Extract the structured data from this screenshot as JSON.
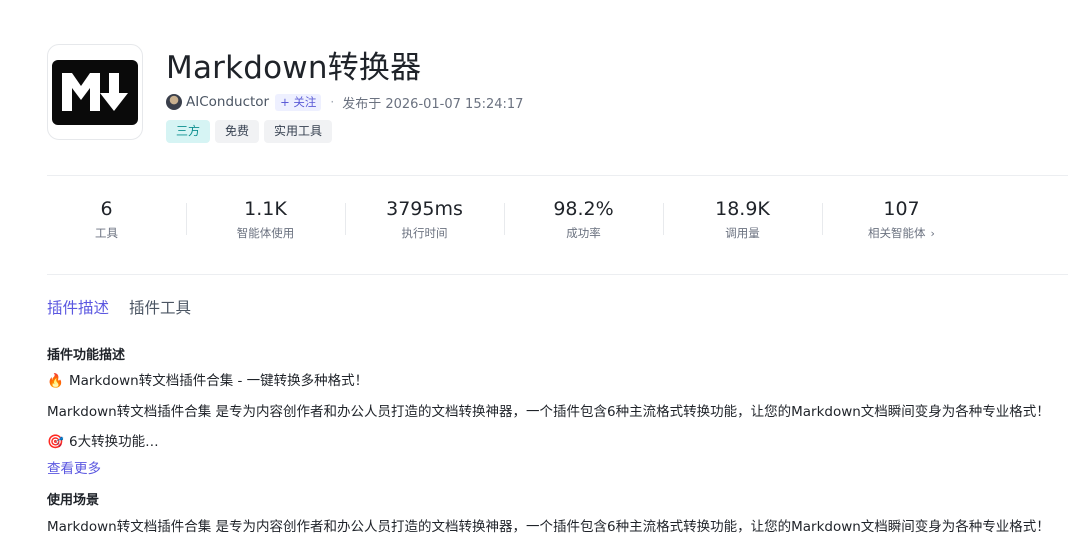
{
  "plugin": {
    "title": "Markdown转换器",
    "author": "AIConductor",
    "follow_label": "+ 关注",
    "separator": "·",
    "published": "发布于 2026-01-07 15:24:17",
    "tags": [
      "三方",
      "免费",
      "实用工具"
    ]
  },
  "stats": [
    {
      "value": "6",
      "label": "工具"
    },
    {
      "value": "1.1K",
      "label": "智能体使用"
    },
    {
      "value": "3795ms",
      "label": "执行时间"
    },
    {
      "value": "98.2%",
      "label": "成功率"
    },
    {
      "value": "18.9K",
      "label": "调用量"
    },
    {
      "value": "107",
      "label": "相关智能体",
      "chevron": "›"
    }
  ],
  "tabs": [
    "插件描述",
    "插件工具"
  ],
  "description": {
    "heading": "插件功能描述",
    "line1_icon": "🔥",
    "line1": "Markdown转文档插件合集 - 一键转换多种格式！",
    "line2": "Markdown转文档插件合集 是专为内容创作者和办公人员打造的文档转换神器，一个插件包含6种主流格式转换功能，让您的Markdown文档瞬间变身为各种专业格式！",
    "line3_icon": "🎯",
    "line3": "6大转换功能…",
    "see_more": "查看更多"
  },
  "usage": {
    "heading": "使用场景",
    "text": "Markdown转文档插件合集 是专为内容创作者和办公人员打造的文档转换神器，一个插件包含6种主流格式转换功能，让您的Markdown文档瞬间变身为各种专业格式！"
  },
  "colors": {
    "accent": "#5b57e0",
    "tag_accent_bg": "#d6f4f4",
    "tag_accent_text": "#0e8f8f"
  }
}
